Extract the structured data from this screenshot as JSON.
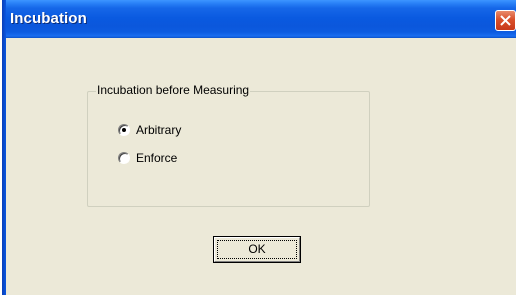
{
  "window": {
    "title": "Incubation",
    "close_icon": "close-icon"
  },
  "group": {
    "legend": "Incubation before Measuring",
    "options": [
      {
        "label": "Arbitrary",
        "selected": true
      },
      {
        "label": "Enforce",
        "selected": false
      }
    ]
  },
  "buttons": {
    "ok_label": "OK"
  },
  "colors": {
    "titlebar": "#0a5ae0",
    "dialog_background": "#ece9d8",
    "close_button": "#d9502b"
  }
}
